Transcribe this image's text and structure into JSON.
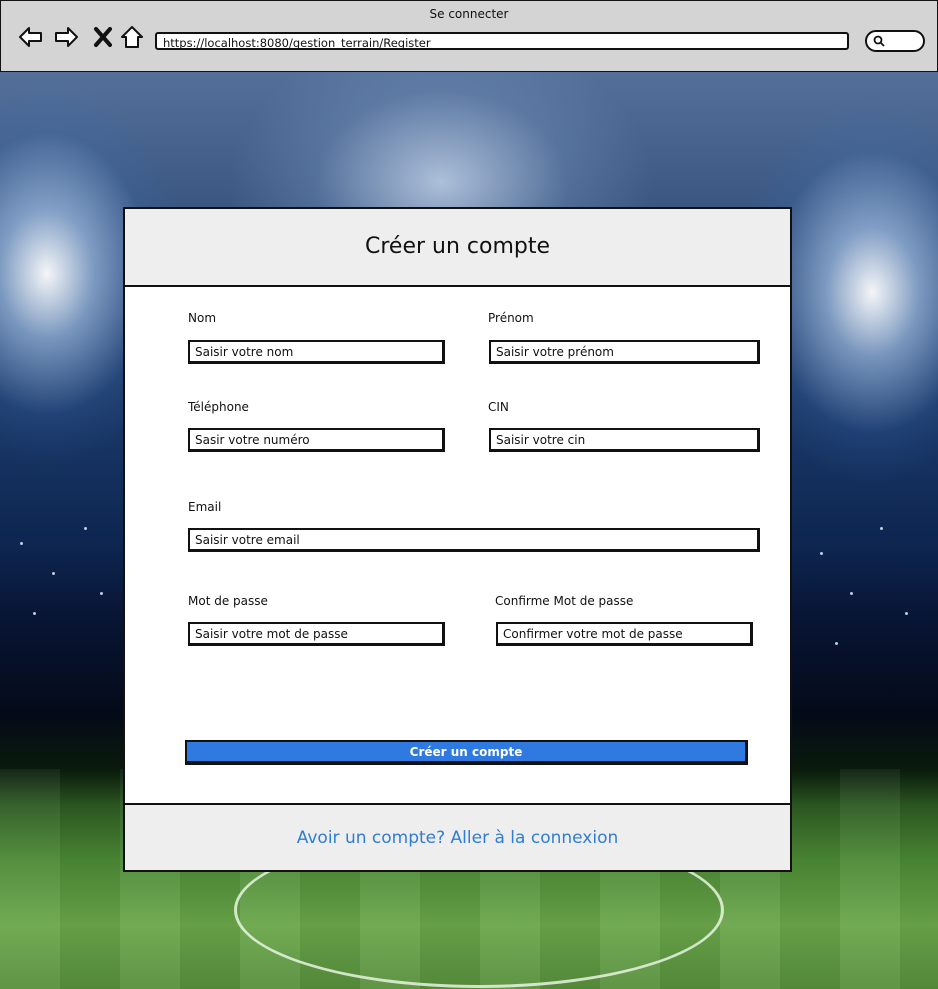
{
  "browser": {
    "window_title": "Se connecter",
    "url": "https://localhost:8080/gestion_terrain/Register",
    "nav_icons": [
      "back-arrow-icon",
      "forward-arrow-icon",
      "close-x-icon",
      "home-icon",
      "search-icon"
    ]
  },
  "form": {
    "title": "Créer un compte",
    "fields": {
      "nom": {
        "label": "Nom",
        "placeholder": "Saisir votre nom"
      },
      "prenom": {
        "label": "Prénom",
        "placeholder": "Saisir votre prénom"
      },
      "telephone": {
        "label": "Téléphone",
        "placeholder": "Sasir votre numéro"
      },
      "cin": {
        "label": "CIN",
        "placeholder": "Saisir votre cin"
      },
      "email": {
        "label": "Email",
        "placeholder": "Saisir votre email"
      },
      "password": {
        "label": "Mot de passe",
        "placeholder": "Saisir votre mot de passe"
      },
      "confirm_password": {
        "label": "Confirme Mot de passe",
        "placeholder": "Confirmer votre mot de passe"
      }
    },
    "submit_label": "Créer un compte",
    "footer_link": "Avoir un compte? Aller à la connexion"
  },
  "colors": {
    "accent": "#2f7ae0",
    "link": "#2f7dd6",
    "chrome": "#d4d4d4",
    "panel": "#eeeeee"
  }
}
